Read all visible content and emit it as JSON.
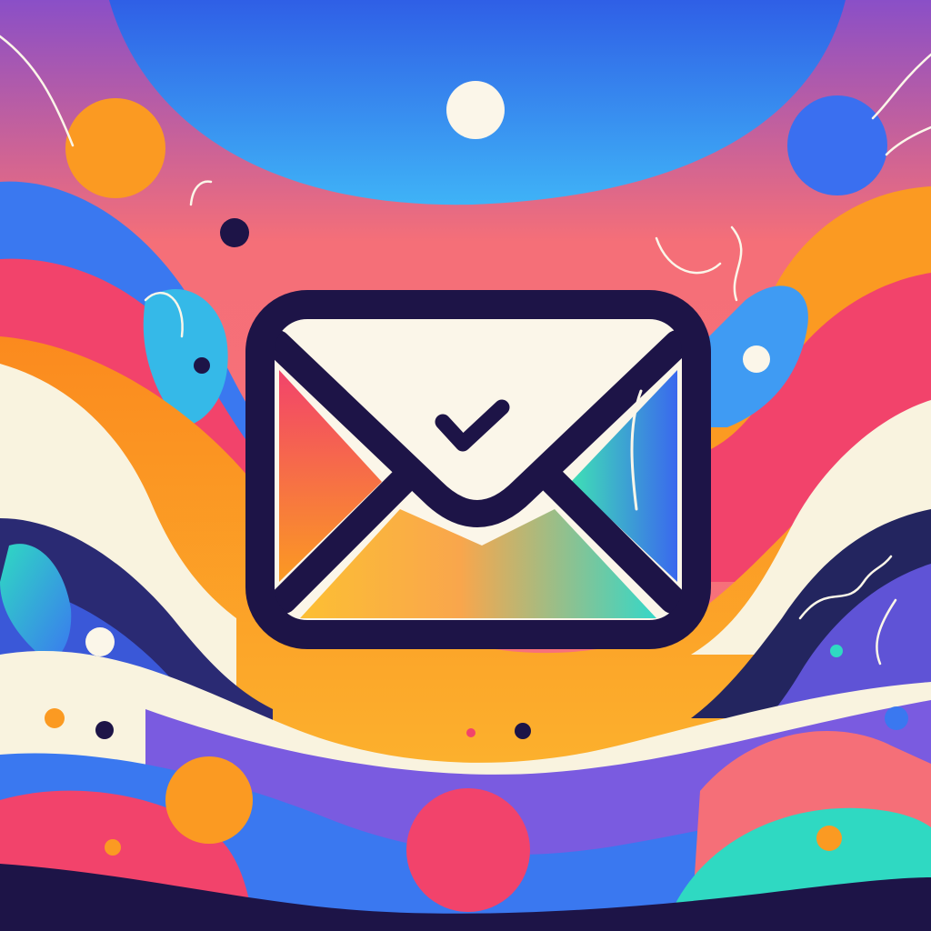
{
  "illustration": {
    "subject": "email-verified-envelope",
    "icons": [
      "envelope-icon",
      "checkmark-icon"
    ],
    "colors": {
      "outline": "#1d1447",
      "paper": "#fbf6e9",
      "blue": "#3a78f0",
      "sky": "#3fa9f5",
      "coral": "#f56f78",
      "pink": "#f2436b",
      "orange": "#fb9a22",
      "yellow": "#fcbf33",
      "cream": "#f9f3df",
      "navy": "#23255f",
      "purple": "#6b4fd8",
      "teal": "#2fd9c2",
      "violet": "#8a4fc7"
    }
  }
}
